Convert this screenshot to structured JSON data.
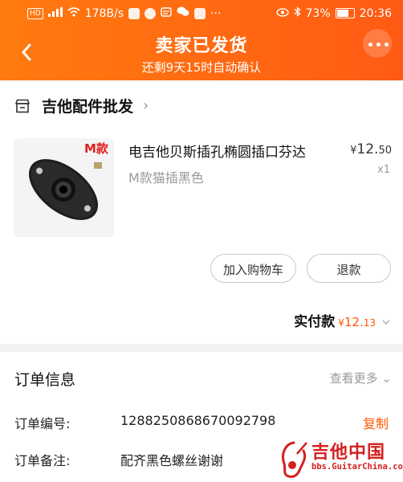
{
  "status_bar": {
    "network_badge": "HD",
    "signal_text": "⁴⁶",
    "speed": "178B/s",
    "battery_pct": "73%",
    "time": "20:36"
  },
  "header": {
    "title": "卖家已发货",
    "subtitle": "还剩9天15时自动确认",
    "accent_colors": [
      "#ff7b0f",
      "#ff5a14"
    ]
  },
  "shop": {
    "name": "吉他配件批发",
    "chevron": "›"
  },
  "item": {
    "image_badge": "M款",
    "title": "电吉他贝斯插孔椭圆插口芬达",
    "sku": "M款猫插黑色",
    "price_symbol": "¥",
    "price_int": "12.",
    "price_dec": "50",
    "quantity": "x1"
  },
  "actions": {
    "add_to_cart": "加入购物车",
    "refund": "退款"
  },
  "payment": {
    "label": "实付款",
    "symbol": "¥",
    "amount_int": "12.",
    "amount_dec": "13"
  },
  "order_info": {
    "title": "订单信息",
    "more": "查看更多",
    "more_chevron": "⌄",
    "rows": [
      {
        "label": "订单编号:",
        "value": "1288250868670092798"
      },
      {
        "label": "订单备注:",
        "value": "配齐黑色螺丝谢谢"
      }
    ],
    "copy": "复制"
  },
  "watermark": {
    "name": "吉他中国",
    "url": "bbs.GuitarChina.com"
  }
}
